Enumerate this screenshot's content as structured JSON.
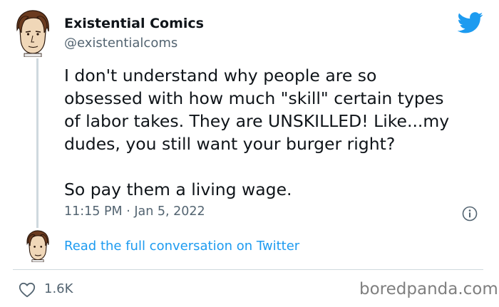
{
  "author": {
    "display_name": "Existential Comics",
    "handle": "@existentialcoms"
  },
  "tweet": {
    "lines": [
      "I don't understand why people are so",
      "obsessed with how much \"skill\" certain types",
      "of labor takes. They are UNSKILLED! Like...my",
      "dudes, you still want your burger right?"
    ],
    "closing": "So pay them a living wage.",
    "timestamp": "11:15 PM · Jan 5, 2022"
  },
  "actions": {
    "read_conversation": "Read the full conversation on Twitter",
    "likes": "1.6K"
  },
  "watermark": "boredpanda.com",
  "icons": {
    "brand": "twitter-bird-icon",
    "info": "info-icon",
    "like": "heart-icon"
  },
  "colors": {
    "twitter_blue": "#1d9bf0",
    "text": "#0f1419",
    "secondary": "#536471",
    "divider": "#cfd9de"
  }
}
